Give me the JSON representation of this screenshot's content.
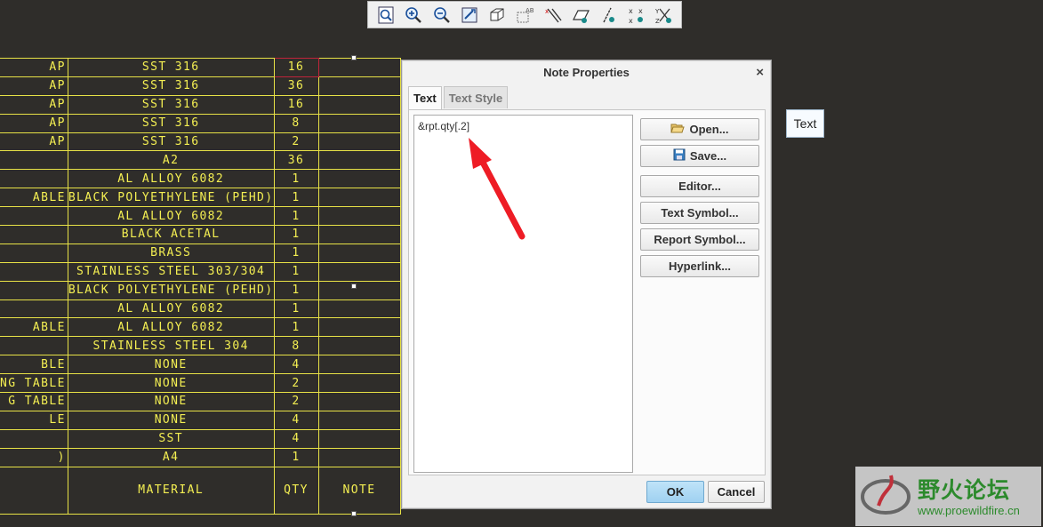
{
  "toolbar": {
    "buttons": [
      "zoom-fit-icon",
      "zoom-in-icon",
      "zoom-out-icon",
      "repaint-icon",
      "view-orientation-icon",
      "annotation-display-icon",
      "datum-axis-display-icon",
      "datum-plane-display-icon",
      "point-display-icon",
      "coordinate-system-display-icon",
      "csys-display-icon"
    ]
  },
  "bom": {
    "rows": [
      [
        "AP",
        "SST 316",
        "16",
        ""
      ],
      [
        "AP",
        "SST 316",
        "36",
        ""
      ],
      [
        "AP",
        "SST 316",
        "16",
        ""
      ],
      [
        "AP",
        "SST 316",
        "8",
        ""
      ],
      [
        "AP",
        "SST 316",
        "2",
        ""
      ],
      [
        "",
        "A2",
        "36",
        ""
      ],
      [
        "",
        "AL ALLOY 6082",
        "1",
        ""
      ],
      [
        "ABLE",
        "BLACK POLYETHYLENE (PEHD)",
        "1",
        ""
      ],
      [
        "",
        "AL ALLOY 6082",
        "1",
        ""
      ],
      [
        "",
        "BLACK ACETAL",
        "1",
        ""
      ],
      [
        "",
        "BRASS",
        "1",
        ""
      ],
      [
        "",
        "STAINLESS STEEL 303/304",
        "1",
        ""
      ],
      [
        "",
        "BLACK POLYETHYLENE (PEHD)",
        "1",
        ""
      ],
      [
        "",
        "AL ALLOY 6082",
        "1",
        ""
      ],
      [
        "ABLE",
        "AL ALLOY 6082",
        "1",
        ""
      ],
      [
        "",
        "STAINLESS STEEL 304",
        "8",
        ""
      ],
      [
        "BLE",
        "NONE",
        "4",
        ""
      ],
      [
        "NG TABLE",
        "NONE",
        "2",
        ""
      ],
      [
        "G TABLE",
        "NONE",
        "2",
        ""
      ],
      [
        "LE",
        "NONE",
        "4",
        ""
      ],
      [
        "",
        "SST",
        "4",
        ""
      ],
      [
        ")",
        "A4",
        "1",
        ""
      ]
    ],
    "header": [
      "",
      "MATERIAL",
      "QTY",
      "NOTE"
    ]
  },
  "dialog": {
    "title": "Note Properties",
    "close": "×",
    "tabs": [
      "Text",
      "Text Style"
    ],
    "text_value": "&rpt.qty[.2]",
    "buttons": {
      "open": "Open...",
      "save": "Save...",
      "editor": "Editor...",
      "text_symbol": "Text Symbol...",
      "report_symbol": "Report Symbol...",
      "hyperlink": "Hyperlink..."
    },
    "ok": "OK",
    "cancel": "Cancel"
  },
  "tooltip": "Text",
  "watermark": {
    "name": "野火论坛",
    "url": "www.proewildfire.cn"
  },
  "colors": {
    "background": "#2f2d2a",
    "table_line": "#e8e246",
    "table_text": "#f4ef52",
    "arrow": "#ee1c25"
  }
}
